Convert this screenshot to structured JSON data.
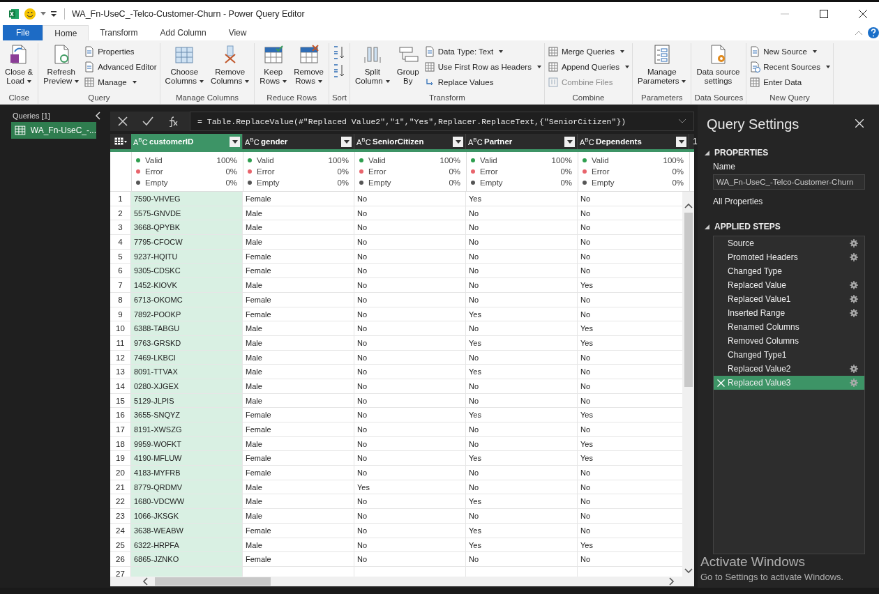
{
  "title_bar": {
    "title": "WA_Fn-UseC_-Telco-Customer-Churn - Power Query Editor"
  },
  "ribbon_tabs": [
    {
      "label": "File",
      "kind": "file",
      "selected": false
    },
    {
      "label": "Home",
      "kind": "tab",
      "selected": true
    },
    {
      "label": "Transform",
      "kind": "tab",
      "selected": false
    },
    {
      "label": "Add Column",
      "kind": "tab",
      "selected": false
    },
    {
      "label": "View",
      "kind": "tab",
      "selected": false
    }
  ],
  "ribbon_groups": [
    {
      "label": "Close",
      "items": [
        {
          "kind": "large",
          "lines": [
            "Close &",
            "Load"
          ],
          "dropdown": true
        }
      ]
    },
    {
      "label": "Query",
      "items": [
        {
          "kind": "large",
          "lines": [
            "Refresh",
            "Preview"
          ],
          "dropdown": true
        },
        {
          "kind": "small",
          "label": "Properties",
          "dropdown": false
        },
        {
          "kind": "small",
          "label": "Advanced Editor",
          "dropdown": false
        },
        {
          "kind": "small",
          "label": "Manage",
          "dropdown": true
        }
      ]
    },
    {
      "label": "Manage Columns",
      "items": [
        {
          "kind": "large",
          "lines": [
            "Choose",
            "Columns"
          ],
          "dropdown": true
        },
        {
          "kind": "large",
          "lines": [
            "Remove",
            "Columns"
          ],
          "dropdown": true
        }
      ]
    },
    {
      "label": "Reduce Rows",
      "items": [
        {
          "kind": "large",
          "lines": [
            "Keep",
            "Rows"
          ],
          "dropdown": true
        },
        {
          "kind": "large",
          "lines": [
            "Remove",
            "Rows"
          ],
          "dropdown": true
        }
      ]
    },
    {
      "label": "Sort",
      "items": [
        {
          "kind": "icon"
        },
        {
          "kind": "icon"
        }
      ]
    },
    {
      "label": "Transform",
      "items": [
        {
          "kind": "large",
          "lines": [
            "Split",
            "Column"
          ],
          "dropdown": true
        },
        {
          "kind": "large",
          "lines": [
            "Group",
            "By"
          ],
          "dropdown": false
        },
        {
          "kind": "small",
          "label": "Data Type: Text",
          "dropdown": true
        },
        {
          "kind": "small",
          "label": "Use First Row as Headers",
          "dropdown": true
        },
        {
          "kind": "small",
          "label": "Replace Values",
          "dropdown": false
        }
      ]
    },
    {
      "label": "Combine",
      "items": [
        {
          "kind": "small",
          "label": "Merge Queries",
          "dropdown": true,
          "disabled": false
        },
        {
          "kind": "small",
          "label": "Append Queries",
          "dropdown": true,
          "disabled": false
        },
        {
          "kind": "small",
          "label": "Combine Files",
          "dropdown": false,
          "disabled": true
        }
      ]
    },
    {
      "label": "Parameters",
      "items": [
        {
          "kind": "large",
          "lines": [
            "Manage",
            "Parameters"
          ],
          "dropdown": true
        }
      ]
    },
    {
      "label": "Data Sources",
      "items": [
        {
          "kind": "large",
          "lines": [
            "Data source",
            "settings"
          ],
          "dropdown": false
        }
      ]
    },
    {
      "label": "New Query",
      "items": [
        {
          "kind": "small",
          "label": "New Source",
          "dropdown": true
        },
        {
          "kind": "small",
          "label": "Recent Sources",
          "dropdown": true
        },
        {
          "kind": "small",
          "label": "Enter Data",
          "dropdown": false
        }
      ]
    }
  ],
  "queries_panel": {
    "header": "Queries [1]",
    "items": [
      {
        "label": "WA_Fn-UseC_-...",
        "selected": true
      }
    ]
  },
  "formula_bar": {
    "text": "= Table.ReplaceValue(#\"Replaced Value2\",\"1\",\"Yes\",Replacer.ReplaceText,{\"SeniorCitizen\"})"
  },
  "table": {
    "columns": [
      {
        "name": "customerID",
        "type_label": "A$^{B}$C",
        "selected": true,
        "quality": [
          {
            "label": "Valid",
            "value": "100%",
            "color": "#2e9e4f"
          },
          {
            "label": "Error",
            "value": "0%",
            "color": "#e8646c"
          },
          {
            "label": "Empty",
            "value": "0%",
            "color": "#555555"
          }
        ]
      },
      {
        "name": "gender",
        "type_label": "A$^{B}$C",
        "selected": false,
        "quality": [
          {
            "label": "Valid",
            "value": "100%",
            "color": "#2e9e4f"
          },
          {
            "label": "Error",
            "value": "0%",
            "color": "#e8646c"
          },
          {
            "label": "Empty",
            "value": "0%",
            "color": "#555555"
          }
        ]
      },
      {
        "name": "SeniorCitizen",
        "type_label": "A$^{B}$C",
        "selected": false,
        "quality": [
          {
            "label": "Valid",
            "value": "100%",
            "color": "#2e9e4f"
          },
          {
            "label": "Error",
            "value": "0%",
            "color": "#e8646c"
          },
          {
            "label": "Empty",
            "value": "0%",
            "color": "#555555"
          }
        ]
      },
      {
        "name": "Partner",
        "type_label": "A$^{B}$C",
        "selected": false,
        "quality": [
          {
            "label": "Valid",
            "value": "100%",
            "color": "#2e9e4f"
          },
          {
            "label": "Error",
            "value": "0%",
            "color": "#e8646c"
          },
          {
            "label": "Empty",
            "value": "0%",
            "color": "#555555"
          }
        ]
      },
      {
        "name": "Dependents",
        "type_label": "A$^{B}$C",
        "selected": false,
        "quality": [
          {
            "label": "Valid",
            "value": "100%",
            "color": "#2e9e4f"
          },
          {
            "label": "Error",
            "value": "0%",
            "color": "#e8646c"
          },
          {
            "label": "Empty",
            "value": "0%",
            "color": "#555555"
          }
        ]
      }
    ],
    "cut_header": "1",
    "rows": [
      {
        "number": "1",
        "cells": [
          "7590-VHVEG",
          "Female",
          "No",
          "Yes",
          "No"
        ]
      },
      {
        "number": "2",
        "cells": [
          "5575-GNVDE",
          "Male",
          "No",
          "No",
          "No"
        ]
      },
      {
        "number": "3",
        "cells": [
          "3668-QPYBK",
          "Male",
          "No",
          "No",
          "No"
        ]
      },
      {
        "number": "4",
        "cells": [
          "7795-CFOCW",
          "Male",
          "No",
          "No",
          "No"
        ]
      },
      {
        "number": "5",
        "cells": [
          "9237-HQITU",
          "Female",
          "No",
          "No",
          "No"
        ]
      },
      {
        "number": "6",
        "cells": [
          "9305-CDSKC",
          "Female",
          "No",
          "No",
          "No"
        ]
      },
      {
        "number": "7",
        "cells": [
          "1452-KIOVK",
          "Male",
          "No",
          "No",
          "Yes"
        ]
      },
      {
        "number": "8",
        "cells": [
          "6713-OKOMC",
          "Female",
          "No",
          "No",
          "No"
        ]
      },
      {
        "number": "9",
        "cells": [
          "7892-POOKP",
          "Female",
          "No",
          "Yes",
          "No"
        ]
      },
      {
        "number": "10",
        "cells": [
          "6388-TABGU",
          "Male",
          "No",
          "No",
          "Yes"
        ]
      },
      {
        "number": "11",
        "cells": [
          "9763-GRSKD",
          "Male",
          "No",
          "Yes",
          "Yes"
        ]
      },
      {
        "number": "12",
        "cells": [
          "7469-LKBCI",
          "Male",
          "No",
          "No",
          "No"
        ]
      },
      {
        "number": "13",
        "cells": [
          "8091-TTVAX",
          "Male",
          "No",
          "Yes",
          "No"
        ]
      },
      {
        "number": "14",
        "cells": [
          "0280-XJGEX",
          "Male",
          "No",
          "No",
          "No"
        ]
      },
      {
        "number": "15",
        "cells": [
          "5129-JLPIS",
          "Male",
          "No",
          "No",
          "No"
        ]
      },
      {
        "number": "16",
        "cells": [
          "3655-SNQYZ",
          "Female",
          "No",
          "Yes",
          "Yes"
        ]
      },
      {
        "number": "17",
        "cells": [
          "8191-XWSZG",
          "Female",
          "No",
          "No",
          "No"
        ]
      },
      {
        "number": "18",
        "cells": [
          "9959-WOFKT",
          "Male",
          "No",
          "No",
          "Yes"
        ]
      },
      {
        "number": "19",
        "cells": [
          "4190-MFLUW",
          "Female",
          "No",
          "Yes",
          "Yes"
        ]
      },
      {
        "number": "20",
        "cells": [
          "4183-MYFRB",
          "Female",
          "No",
          "No",
          "No"
        ]
      },
      {
        "number": "21",
        "cells": [
          "8779-QRDMV",
          "Male",
          "Yes",
          "No",
          "No"
        ]
      },
      {
        "number": "22",
        "cells": [
          "1680-VDCWW",
          "Male",
          "No",
          "Yes",
          "No"
        ]
      },
      {
        "number": "23",
        "cells": [
          "1066-JKSGK",
          "Male",
          "No",
          "No",
          "No"
        ]
      },
      {
        "number": "24",
        "cells": [
          "3638-WEABW",
          "Female",
          "No",
          "Yes",
          "No"
        ]
      },
      {
        "number": "25",
        "cells": [
          "6322-HRPFA",
          "Male",
          "No",
          "Yes",
          "Yes"
        ]
      },
      {
        "number": "26",
        "cells": [
          "6865-JZNKO",
          "Female",
          "No",
          "No",
          "No"
        ]
      },
      {
        "number": "27",
        "cells": []
      }
    ]
  },
  "query_settings": {
    "title": "Query Settings",
    "properties_heading": "PROPERTIES",
    "name_label": "Name",
    "name_value": "WA_Fn-UseC_-Telco-Customer-Churn",
    "all_properties": "All Properties",
    "steps_heading": "APPLIED STEPS",
    "steps": [
      {
        "label": "Source",
        "settings": true,
        "selected": false
      },
      {
        "label": "Promoted Headers",
        "settings": true,
        "selected": false
      },
      {
        "label": "Changed Type",
        "settings": false,
        "selected": false
      },
      {
        "label": "Replaced Value",
        "settings": true,
        "selected": false
      },
      {
        "label": "Replaced Value1",
        "settings": true,
        "selected": false
      },
      {
        "label": "Inserted Range",
        "settings": true,
        "selected": false
      },
      {
        "label": "Renamed Columns",
        "settings": false,
        "selected": false
      },
      {
        "label": "Removed Columns",
        "settings": false,
        "selected": false
      },
      {
        "label": "Changed Type1",
        "settings": false,
        "selected": false
      },
      {
        "label": "Replaced Value2",
        "settings": true,
        "selected": false
      },
      {
        "label": "Replaced Value3",
        "settings": true,
        "selected": true
      }
    ]
  },
  "activation_notice": {
    "title": "Activate Windows",
    "subtitle": "Go to Settings to activate Windows."
  }
}
